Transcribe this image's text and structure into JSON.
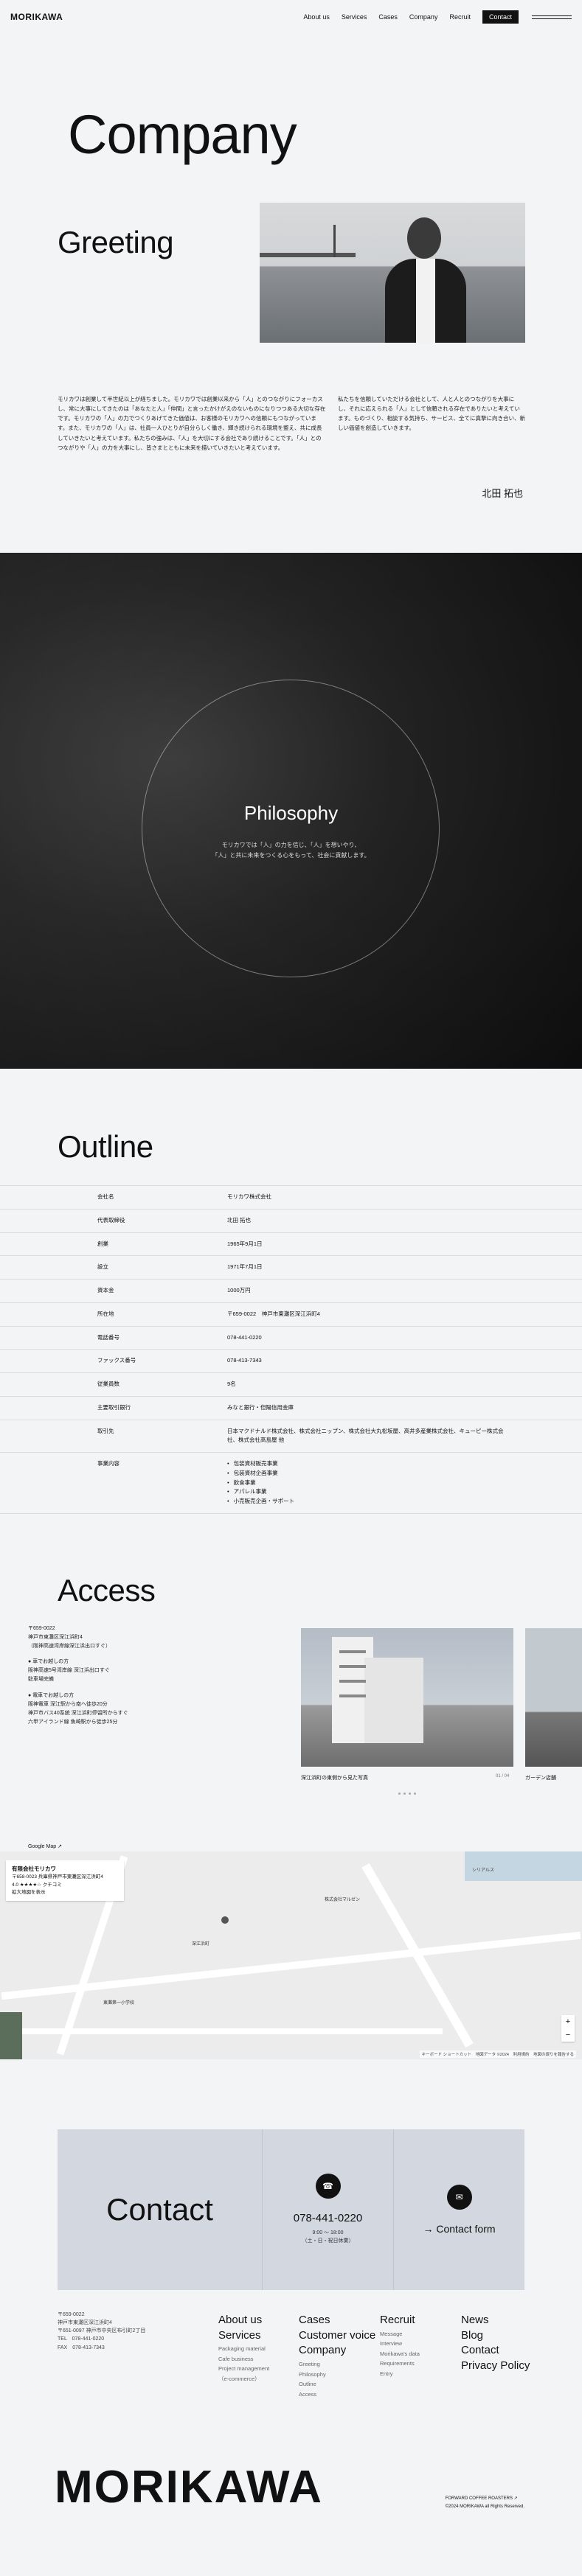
{
  "header": {
    "logo": "MORIKAWA",
    "nav": [
      "About us",
      "Services",
      "Cases",
      "Company",
      "Recruit"
    ],
    "contact_label": "Contact"
  },
  "hero": {
    "title": "Company"
  },
  "greeting": {
    "title": "Greeting",
    "left_text": "モリカワは創業して半世紀以上が経ちました。モリカワでは創業以来から「人」とのつながりにフォーカスし、常に大事にしてきたのは「あなたと人」「仲間」と言ったかけがえのないものになりつつある大切な存在です。モリカワの「人」の力でつくりあげてきた価値は、お客様のモリカワへの信頼にもつながっています。また、モリカワの「人」は、社員一人ひとりが自分らしく働き、輝き続けられる環境を整え、共に成長していきたいと考えています。私たちの強みは、「人」を大切にする会社であり続けることです。「人」とのつながりや「人」の力を大事にし、皆さまとともに未来を描いていきたいと考えています。",
    "right_text": "私たちを信頼していただける会社として、人と人とのつながりを大事にし、それに応えられる「人」として信頼される存在でありたいと考えています。ものづくり、相談する気持ち、サービス、全てに真摯に向き合い、新しい価値を創造していきます。",
    "signature": "北田 拓也"
  },
  "philosophy": {
    "title": "Philosophy",
    "lines": [
      "モリカワでは「人」の力を信じ、「人」を想いやり、",
      "「人」と共に未来をつくる心をもって、社会に貢献します。"
    ]
  },
  "outline": {
    "title": "Outline",
    "rows": [
      {
        "k": "会社名",
        "v": "モリカワ株式会社"
      },
      {
        "k": "代表取締役",
        "v": "北田 拓也"
      },
      {
        "k": "創業",
        "v": "1965年9月1日"
      },
      {
        "k": "設立",
        "v": "1971年7月1日"
      },
      {
        "k": "資本金",
        "v": "1000万円"
      },
      {
        "k": "所在地",
        "v": "〒659-0022　神戸市東灘区深江浜町4"
      },
      {
        "k": "電話番号",
        "v": "078-441-0220"
      },
      {
        "k": "ファックス番号",
        "v": "078-413-7343"
      },
      {
        "k": "従業員数",
        "v": "9名"
      },
      {
        "k": "主要取引銀行",
        "v": "みなと銀行・但陽信用金庫"
      },
      {
        "k": "取引先",
        "v": "日本マクドナルド株式会社、株式会社ニップン、株式会社大丸松坂屋、高井多産業株式会社、キューピー株式会社、株式会社高島屋 他"
      },
      {
        "k": "事業内容",
        "v": "",
        "list": [
          "包装資材販売事業",
          "包装資材企画事業",
          "飲食事業",
          "アパレル事業",
          "小売販売企画・サポート"
        ]
      }
    ]
  },
  "access": {
    "title": "Access",
    "postal": "〒659-0022",
    "address": "神戸市東灘区深江浜町4",
    "address_note": "（阪神高速湾岸線深江浜出口すぐ）",
    "car_title": "車でお越しの方",
    "car_lines": [
      "阪神高速5号湾岸線 深江浜出口すぐ",
      "駐車場完備"
    ],
    "train_title": "電車でお越しの方",
    "train_lines": [
      "阪神電車 深江駅から南へ徒歩20分",
      "神戸市バス40系統 深江浜町停留所からすぐ",
      "六甲アイランド線 魚崎駅から徒歩25分"
    ],
    "caption1": "深江浜町の東側から見た写真",
    "caption1_count": "01 / 04",
    "caption2": "ガーデン店舗"
  },
  "map": {
    "link": "Google Map ↗",
    "place": "有限会社モリカワ",
    "place_address": "〒658-0023 兵庫県神戸市東灘区深江浜町4",
    "rating": "4.0 ★★★★☆ クチコミ",
    "view_larger": "拡大地図を表示",
    "labels": [
      "株式会社マルゼン",
      "深江浜町",
      "東灘第一小学校",
      "シリアルス"
    ],
    "footer": "キーボード ショートカット　地図データ ©2024　利用規約　地図の誤りを報告する"
  },
  "contact": {
    "title": "Contact",
    "tel": "078-441-0220",
    "hours": [
      "9:00 〜 18:00",
      "（土・日・祝日休業）"
    ],
    "form_label": "→ Contact form",
    "phone_icon": "phone-icon",
    "mail_icon": "mail-icon"
  },
  "footer": {
    "address_lines": [
      "〒659-0022",
      "神戸市東灘区深江浜町4",
      "〒651-0097 神戸市中央区布引町2丁目",
      "TEL　078-441-0220",
      "FAX　078-413-7343"
    ],
    "col1": {
      "main": [
        "About us",
        "Services"
      ],
      "sub": [
        "Packaging material",
        "Cafe business",
        "Project management",
        "（e-commerce）"
      ]
    },
    "col2": {
      "main": [
        "Cases",
        "Customer voice",
        "Company"
      ],
      "sub": [
        "Greeting",
        "Philosophy",
        "Outline",
        "Access"
      ]
    },
    "col3": {
      "main": [
        "Recruit"
      ],
      "sub": [
        "Message",
        "Interview",
        "Morikawa's data",
        "Requirements",
        "Entry"
      ]
    },
    "col4": {
      "main": [
        "News",
        "Blog",
        "Contact",
        "Privacy Policy"
      ],
      "sub": []
    },
    "big_logo": "MORIKAWA",
    "right_lines": [
      "FORWARD COFFEE ROASTERS ↗",
      "©2024 MORIKAWA all Rights Reserved."
    ]
  }
}
